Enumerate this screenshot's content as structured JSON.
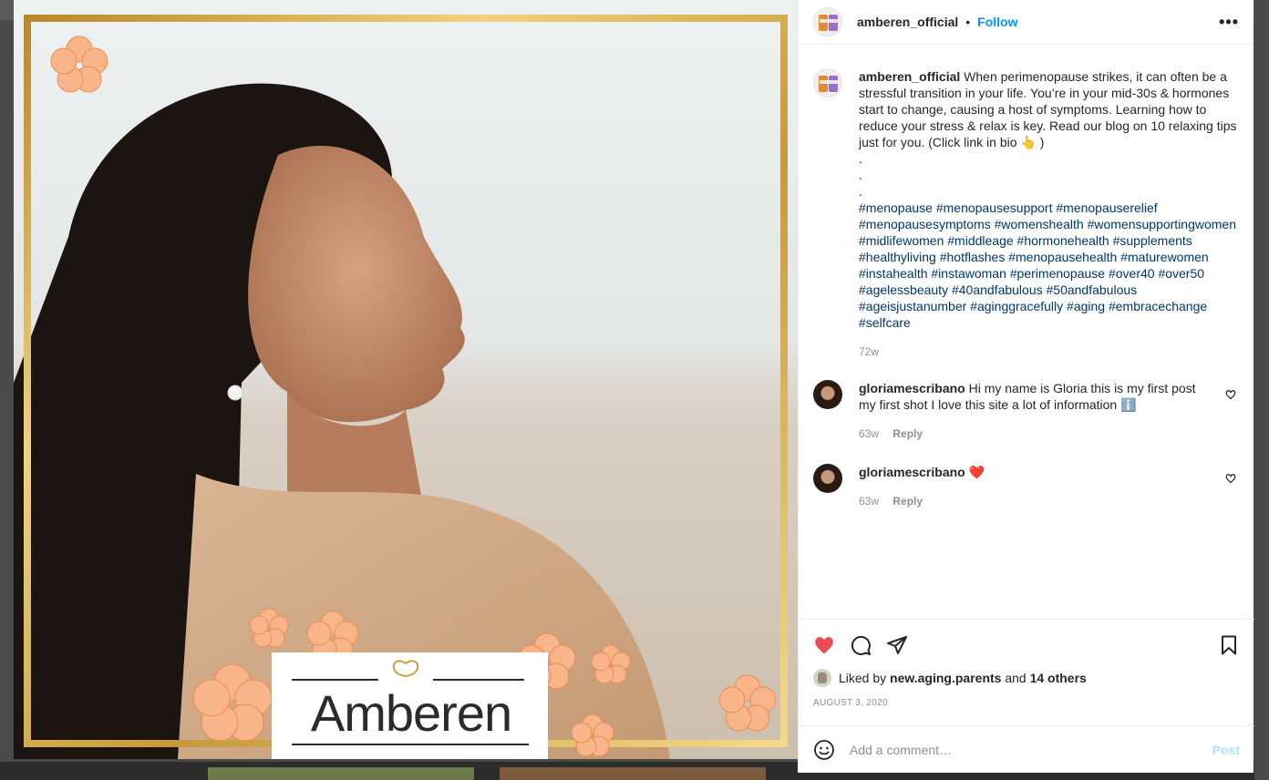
{
  "colors": {
    "accent": "#0095f6",
    "hashtag": "#00376b",
    "like_red": "#ed4956",
    "muted": "#8e8e8e",
    "post_disabled": "#b2dffc"
  },
  "media": {
    "logo_text": "Amberen"
  },
  "header": {
    "username": "amberen_official",
    "separator": "•",
    "follow_label": "Follow",
    "more_icon": "more-horizontal-icon"
  },
  "caption": {
    "username": "amberen_official",
    "text": "When perimenopause strikes, it can often be a stressful transition in your life. You’re in your mid-30s & hormones start to change, causing a host of symptoms. Learning how to reduce your stress & relax is key. Read our blog on 10 relaxing tips just for you. (Click link in bio 👆 )",
    "dots": [
      ".",
      ".",
      "."
    ],
    "hashtags": "#menopause #menopausesupport #menopauserelief #menopausesymptoms #womenshealth #womensupportingwomen #midlifewomen #middleage #hormonehealth #supplements #healthyliving #hotflashes #menopausehealth #maturewomen #instahealth #instawoman #perimenopause #over40 #over50 #agelessbeauty #40andfabulous #50andfabulous #ageisjustanumber #aginggracefully #aging #embracechange #selfcare",
    "age": "72w"
  },
  "comments": [
    {
      "username": "gloriamescribano",
      "text": "Hi my name is Gloria this is my first post my first shot I love this site a lot of information ℹ️",
      "age": "63w",
      "reply_label": "Reply"
    },
    {
      "username": "gloriamescribano",
      "text": "❤️",
      "age": "63w",
      "reply_label": "Reply"
    }
  ],
  "actions": {
    "liked_by_prefix": "Liked by",
    "liked_by_user": "new.aging.parents",
    "liked_by_and": "and",
    "liked_by_others": "14 others",
    "date": "AUGUST 3, 2020",
    "like_icon": "heart-filled-icon",
    "comment_icon": "comment-icon",
    "share_icon": "send-icon",
    "save_icon": "bookmark-icon"
  },
  "add_comment": {
    "placeholder": "Add a comment…",
    "post_label": "Post",
    "emoji_icon": "emoji-icon"
  }
}
